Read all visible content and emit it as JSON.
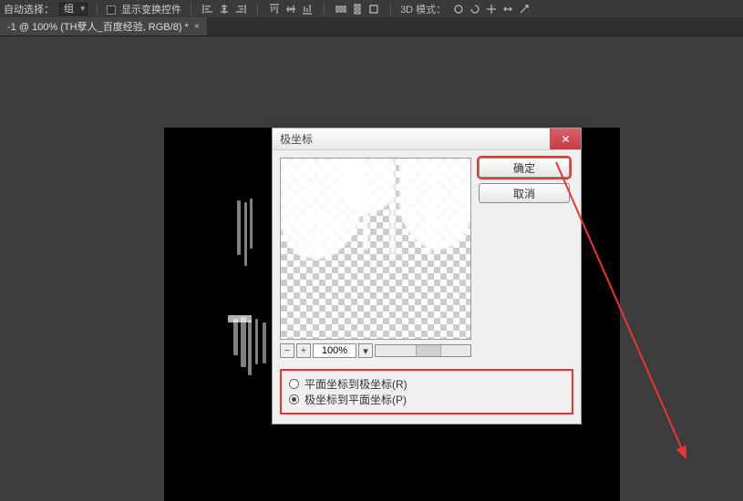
{
  "options": {
    "auto_select_label": "自动选择：",
    "group_value": "组",
    "show_transform_label": "显示变换控件",
    "mode_3d_label": "3D 模式："
  },
  "tab": {
    "title": "-1 @ 100% (TH孽人_百度经验, RGB/8) *"
  },
  "dialog": {
    "title": "极坐标",
    "ok": "确定",
    "cancel": "取消",
    "radio_rect_to_polar": "平面坐标到极坐标(R)",
    "radio_polar_to_rect": "极坐标到平面坐标(P)",
    "zoom_value": "100%"
  }
}
